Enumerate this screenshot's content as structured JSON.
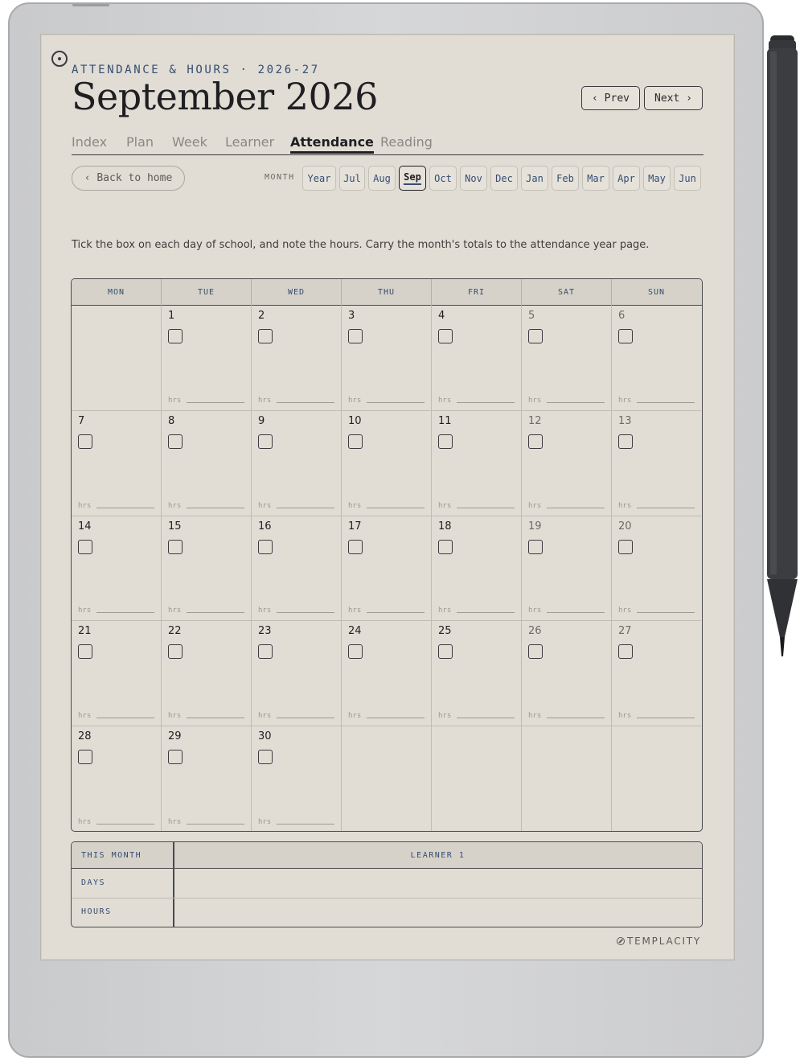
{
  "header": {
    "kicker": "ATTENDANCE & HOURS · 2026-27",
    "title": "September 2026",
    "prev_label": "‹ Prev",
    "next_label": "Next ›"
  },
  "tabs": [
    {
      "label": "Index",
      "active": false
    },
    {
      "label": "Plan",
      "active": false
    },
    {
      "label": "Week",
      "active": false
    },
    {
      "label": "Learner",
      "active": false
    },
    {
      "label": "Attendance",
      "active": true
    },
    {
      "label": "Reading",
      "active": false
    }
  ],
  "nav": {
    "back_label": "‹ Back to home",
    "month_label": "MONTH",
    "months": [
      "Year",
      "Jul",
      "Aug",
      "Sep",
      "Oct",
      "Nov",
      "Dec",
      "Jan",
      "Feb",
      "Mar",
      "Apr",
      "May",
      "Jun"
    ],
    "active_month": "Sep"
  },
  "intro": "Tick the box on each day of school, and note the hours. Carry the month's totals to the attendance year page.",
  "calendar": {
    "weekdays": [
      "MON",
      "TUE",
      "WED",
      "THU",
      "FRI",
      "SAT",
      "SUN"
    ],
    "first_weekday_index": 1,
    "days_in_month": 30,
    "hours_label": "hrs"
  },
  "summary": {
    "header_label": "THIS MONTH",
    "learner_label": "LEARNER 1",
    "rows": [
      "DAYS",
      "HOURS"
    ]
  },
  "brand": "TEMPLACITY",
  "colors": {
    "accent": "#344d72",
    "paper": "#e1ddd5",
    "ink": "#1f1f22"
  }
}
